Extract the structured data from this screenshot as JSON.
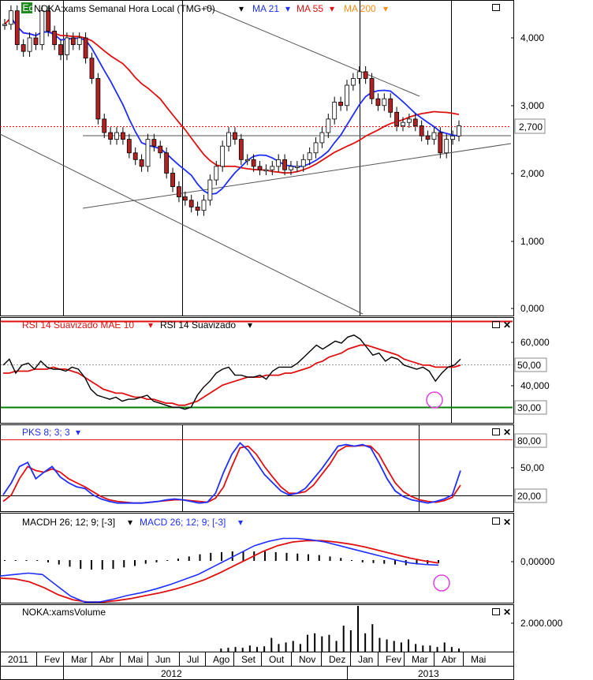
{
  "colors": {
    "up": "#ffffff",
    "down": "#b22222",
    "ma21": "#1f2fff",
    "ma55": "#e01010",
    "ma200": "#ff8c1a",
    "rsi": "#000000",
    "rsi_mae": "#e01010",
    "pks_k": "#1f2fff",
    "pks_d": "#e01010",
    "macdh": "#000000",
    "macd": "#1f2fff",
    "macd_signal": "#e01010",
    "overbought": "#e01010",
    "oversold": "#008000",
    "price_line": "#e01010",
    "circle": "#e040e0"
  },
  "header": {
    "icon_text": "Eq",
    "symbol_text": "NOKA:xams Semanal Hora Local (TMG+0)",
    "ma21_label": "MA 21",
    "ma55_label": "MA 55",
    "ma200_label": "MA 200"
  },
  "rsi_header": {
    "mae_label": "RSI 14 Suavizado MAE 10",
    "rsi_label": "RSI 14 Suavizado"
  },
  "pks_header": {
    "label": "PKS 8; 3; 3"
  },
  "macd_header": {
    "macdh_label": "MACDH 26; 12; 9; [-3]",
    "macd_label": "MACD 26; 12; 9; [-3]"
  },
  "volume_header": {
    "label": "NOKA:xamsVolume"
  },
  "price_axis": {
    "ticks": [
      "4,000",
      "3,000",
      "2,000",
      "1,000",
      "0,000"
    ],
    "last_price": "2,700"
  },
  "rsi_axis": {
    "ticks": [
      "60,000",
      "50,00",
      "40,000",
      "30,00"
    ]
  },
  "pks_axis": {
    "ticks": [
      "80,00",
      "50,00",
      "20,00"
    ]
  },
  "macd_axis": {
    "ticks": [
      "0,00000"
    ]
  },
  "volume_axis": {
    "ticks": [
      "2.000.000"
    ]
  },
  "time_axis": {
    "months": [
      "2011",
      "Fev",
      "Mar",
      "Abr",
      "Mai",
      "Jun",
      "Jul",
      "Ago",
      "Set",
      "Out",
      "Nov",
      "Dez",
      "Jan",
      "Fev",
      "Mar",
      "Abr",
      "Mai"
    ],
    "years": [
      "2012",
      "2013"
    ]
  },
  "chart_data": {
    "type": "candlestick",
    "price": {
      "ylim": [
        0,
        4.5
      ],
      "weeks": 66,
      "closes": [
        4.2,
        4.4,
        3.9,
        3.8,
        4.0,
        3.9,
        4.4,
        4.1,
        3.9,
        3.75,
        4.0,
        3.9,
        4.0,
        3.7,
        3.4,
        2.8,
        2.6,
        2.5,
        2.6,
        2.5,
        2.3,
        2.2,
        2.1,
        2.5,
        2.4,
        2.3,
        2.0,
        1.8,
        1.65,
        1.6,
        1.5,
        1.45,
        1.6,
        1.9,
        2.1,
        2.4,
        2.6,
        2.5,
        2.2,
        2.2,
        2.1,
        2.05,
        2.05,
        2.1,
        2.2,
        2.05,
        2.1,
        2.1,
        2.2,
        2.3,
        2.45,
        2.6,
        2.8,
        3.05,
        3.0,
        3.3,
        3.4,
        3.5,
        3.4,
        3.1,
        3.0,
        3.1,
        2.9,
        2.7,
        2.75,
        2.8,
        2.7,
        2.55,
        2.5,
        2.6,
        2.3,
        2.5,
        2.55,
        2.7
      ],
      "ma21_end": 2.8,
      "ma55_end": 2.4,
      "last_price": 2.7,
      "reference_line": 2.6
    },
    "rsi": {
      "ylim": [
        20,
        70
      ],
      "overbought": 70,
      "oversold": 30,
      "mid": 50,
      "rsi": [
        48,
        51,
        44,
        48,
        49,
        46,
        50,
        47,
        46,
        46,
        45,
        47,
        46,
        42,
        36,
        33,
        32,
        31,
        32,
        30,
        31,
        31,
        32,
        33,
        30,
        29,
        28,
        27,
        27,
        26,
        27,
        33,
        37,
        40,
        44,
        46,
        47,
        43,
        43,
        42,
        42,
        43,
        41,
        45,
        47,
        47,
        47,
        49,
        52,
        55,
        58,
        56,
        58,
        60,
        59,
        62,
        63,
        61,
        57,
        53,
        54,
        50,
        52,
        51,
        48,
        47,
        46,
        47,
        45,
        40,
        44,
        47,
        48,
        51
      ],
      "mae": [
        44,
        44,
        45,
        45,
        45,
        46,
        46,
        46,
        47,
        46,
        46,
        45,
        44,
        42,
        40,
        38,
        36,
        35,
        34,
        34,
        33,
        32,
        32,
        31,
        31,
        30,
        29,
        29,
        28,
        28,
        29,
        30,
        32,
        34,
        36,
        38,
        39,
        40,
        41,
        42,
        42,
        42,
        43,
        43,
        43,
        44,
        44,
        45,
        46,
        47,
        49,
        50,
        52,
        53,
        54,
        56,
        57,
        58,
        58,
        57,
        56,
        55,
        54,
        53,
        51,
        50,
        49,
        48,
        48,
        47,
        47,
        47,
        47,
        48
      ]
    },
    "pks": {
      "ylim": [
        0,
        100
      ],
      "lines": [
        20,
        80
      ],
      "k": [
        20,
        35,
        55,
        60,
        40,
        48,
        55,
        42,
        35,
        30,
        28,
        20,
        15,
        12,
        10,
        10,
        10,
        10,
        11,
        12,
        14,
        15,
        14,
        12,
        10,
        11,
        22,
        48,
        70,
        84,
        75,
        60,
        45,
        35,
        25,
        20,
        22,
        28,
        40,
        52,
        66,
        80,
        82,
        80,
        82,
        78,
        60,
        40,
        25,
        18,
        14,
        12,
        10,
        12,
        15,
        20,
        50
      ],
      "d": [
        12,
        20,
        40,
        55,
        50,
        48,
        52,
        48,
        40,
        35,
        30,
        24,
        18,
        14,
        12,
        11,
        10,
        10,
        11,
        12,
        13,
        14,
        14,
        13,
        12,
        11,
        16,
        30,
        55,
        78,
        80,
        70,
        55,
        42,
        30,
        22,
        22,
        24,
        32,
        45,
        58,
        74,
        80,
        80,
        81,
        80,
        70,
        52,
        35,
        24,
        18,
        14,
        12,
        11,
        13,
        17,
        32
      ]
    },
    "macd": {
      "ylim": [
        -0.6,
        0.6
      ],
      "histogram": [
        0.0,
        0.0,
        0.0,
        0.0,
        -0.02,
        -0.05,
        -0.08,
        -0.11,
        -0.12,
        -0.12,
        -0.11,
        -0.09,
        -0.07,
        -0.04,
        -0.02,
        0.0,
        0.02,
        0.05,
        0.08,
        0.1,
        0.11,
        0.12,
        0.12,
        0.12,
        0.12,
        0.11,
        0.1,
        0.09,
        0.08,
        0.07,
        0.05,
        0.03,
        0.0,
        -0.02,
        -0.03,
        -0.04,
        -0.05,
        -0.06,
        -0.05,
        -0.04,
        -0.03
      ],
      "macd": [
        -0.22,
        -0.2,
        -0.18,
        -0.2,
        -0.35,
        -0.5,
        -0.58,
        -0.58,
        -0.54,
        -0.49,
        -0.45,
        -0.4,
        -0.34,
        -0.27,
        -0.2,
        -0.1,
        0.0,
        0.1,
        0.2,
        0.26,
        0.3,
        0.3,
        0.28,
        0.25,
        0.2,
        0.15,
        0.1,
        0.05,
        0.0,
        -0.04,
        -0.06,
        -0.07
      ],
      "signal": [
        -0.25,
        -0.26,
        -0.3,
        -0.38,
        -0.48,
        -0.55,
        -0.58,
        -0.58,
        -0.56,
        -0.53,
        -0.49,
        -0.45,
        -0.4,
        -0.34,
        -0.27,
        -0.18,
        -0.08,
        0.02,
        0.12,
        0.2,
        0.25,
        0.27,
        0.27,
        0.25,
        0.22,
        0.18,
        0.13,
        0.08,
        0.03,
        -0.01,
        -0.04
      ]
    },
    "volume": {
      "ylim": [
        0,
        3000000
      ],
      "values": [
        0,
        0,
        0,
        0,
        0,
        0,
        0,
        0,
        0,
        0,
        0,
        0,
        0,
        0,
        0,
        0,
        0,
        0,
        0,
        0,
        0,
        0,
        0,
        0,
        0,
        0,
        0,
        0,
        0,
        0,
        200000,
        250000,
        300000,
        250000,
        400000,
        300000,
        350000,
        900000,
        500000,
        600000,
        700000,
        500000,
        1100000,
        1200000,
        1000000,
        1100000,
        700000,
        1700000,
        1400000,
        3000000,
        1200000,
        1800000,
        900000,
        800000,
        700000,
        600000,
        800000,
        500000,
        400000,
        400000,
        300000,
        600000,
        300000,
        200000
      ]
    }
  }
}
